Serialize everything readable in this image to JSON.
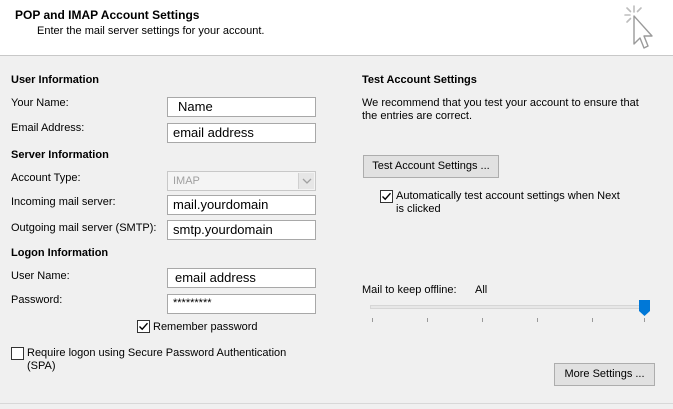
{
  "header": {
    "title": "POP and IMAP Account Settings",
    "subtitle": "Enter the mail server settings for your account."
  },
  "user_info": {
    "heading": "User Information",
    "your_name_label": "Your Name:",
    "your_name_value": "Name",
    "email_label": "Email Address:",
    "email_value": "email address"
  },
  "server_info": {
    "heading": "Server Information",
    "account_type_label": "Account Type:",
    "account_type_value": "IMAP",
    "incoming_label": "Incoming mail server:",
    "incoming_value": "mail.yourdomain",
    "outgoing_label": "Outgoing mail server (SMTP):",
    "outgoing_value": "smtp.yourdomain"
  },
  "logon_info": {
    "heading": "Logon Information",
    "user_name_label": "User Name:",
    "user_name_value": "email address",
    "password_label": "Password:",
    "password_value": "*********",
    "remember_password_label": "Remember password",
    "remember_password_checked": true,
    "spa_label_line1": "Require logon using Secure Password Authentication",
    "spa_label_line2": "(SPA)",
    "spa_checked": false
  },
  "test_settings": {
    "heading": "Test Account Settings",
    "desc_line1": "We recommend that you test your account to ensure that",
    "desc_line2": "the entries are correct.",
    "test_button_label": "Test Account Settings ...",
    "auto_test_label_line1": "Automatically test account settings when Next",
    "auto_test_label_line2": "is clicked",
    "auto_test_checked": true
  },
  "offline": {
    "label": "Mail to keep offline:",
    "value": "All",
    "slider_level_fraction": 1.0
  },
  "more_settings_label": "More Settings ..."
}
